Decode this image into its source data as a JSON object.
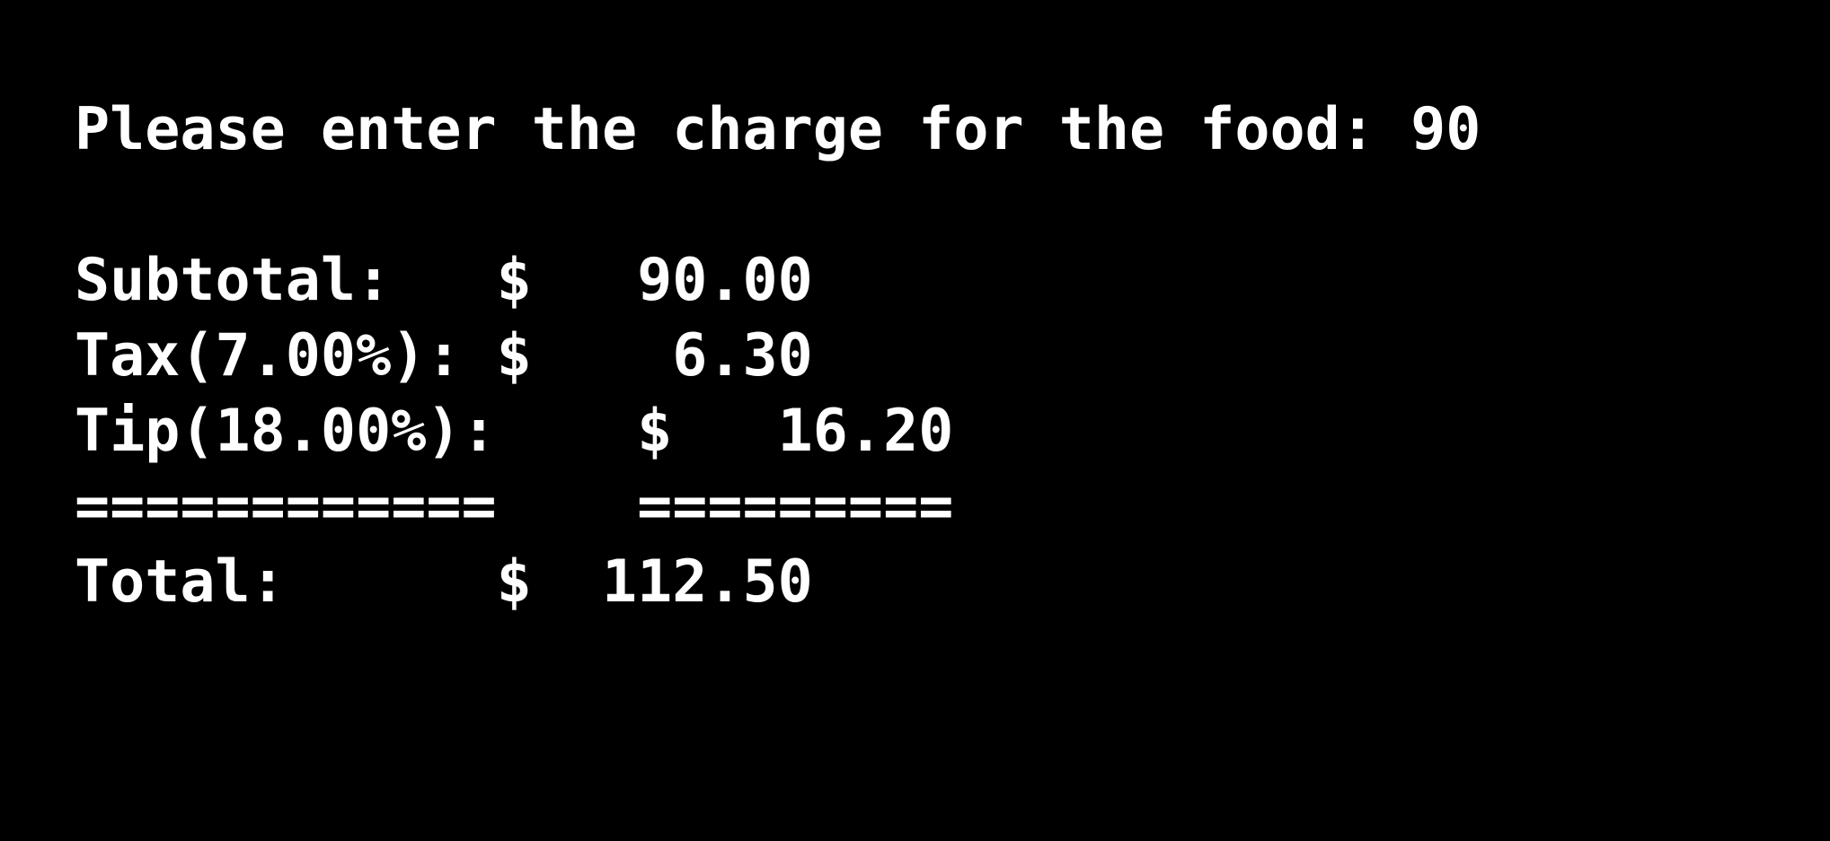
{
  "terminal": {
    "prompt_line": "Please enter the charge for the food: 90",
    "subtotal_line": "Subtotal:   $   90.00",
    "tax_line": "Tax(7.00%): $    6.30",
    "tip_line": "Tip(18.00%):    $   16.20",
    "separator_line": "============    =========",
    "total_line": "Total:      $  112.50"
  },
  "colors": {
    "background": "#000000",
    "text": "#ffffff"
  }
}
